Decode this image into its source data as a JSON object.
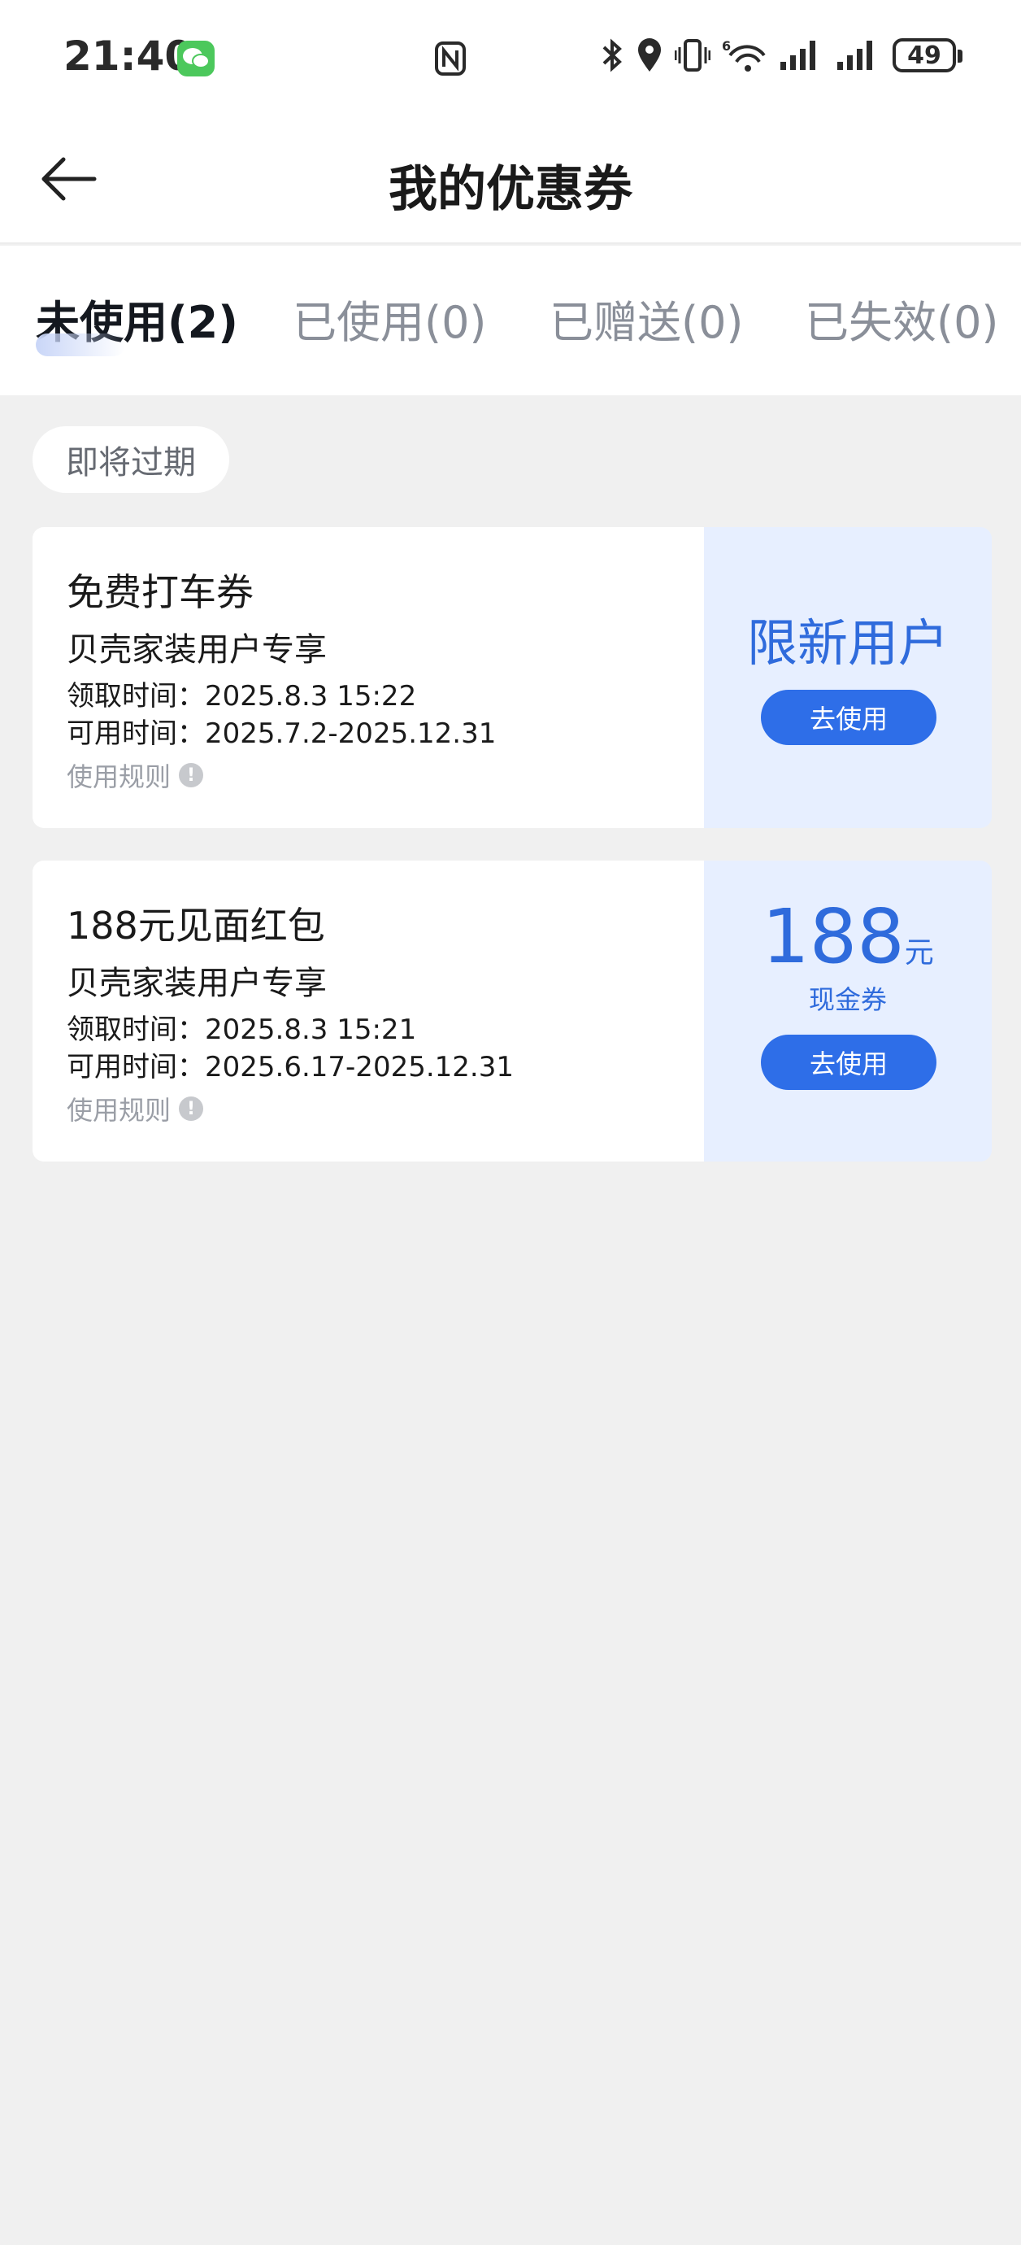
{
  "status_bar": {
    "time": "21:40",
    "battery": "49",
    "network_badge": "6"
  },
  "header": {
    "title": "我的优惠券"
  },
  "tabs": [
    {
      "label": "未使用(2)",
      "active": true
    },
    {
      "label": "已使用(0)",
      "active": false
    },
    {
      "label": "已赠送(0)",
      "active": false
    },
    {
      "label": "已失效(0)",
      "active": false
    }
  ],
  "section": {
    "label": "即将过期"
  },
  "coupons": [
    {
      "name": "免费打车券",
      "subtitle": "贝壳家装用户专享",
      "received": "领取时间：2025.8.3 15:22",
      "available": "可用时间：2025.7.2-2025.12.31",
      "rules": "使用规则",
      "badge": "限新用户",
      "button": "去使用"
    },
    {
      "name": "188元见面红包",
      "subtitle": "贝壳家装用户专享",
      "received": "领取时间：2025.8.3 15:21",
      "available": "可用时间：2025.6.17-2025.12.31",
      "rules": "使用规则",
      "amount": "188",
      "unit": "元",
      "type": "现金券",
      "button": "去使用"
    }
  ],
  "colors": {
    "accent": "#2e6ee8",
    "accent_text": "#2f6bdc",
    "coupon_right_bg": "#e7efff",
    "page_bg": "#f0f0f0"
  }
}
